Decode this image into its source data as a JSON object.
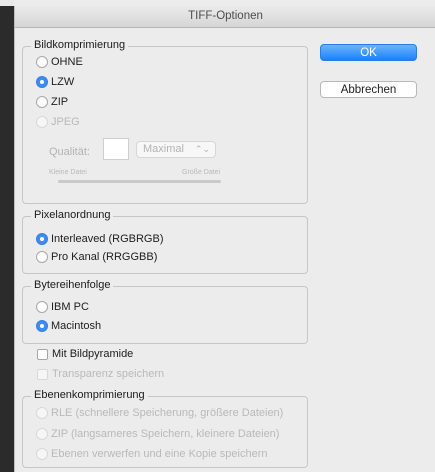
{
  "window": {
    "title": "TIFF-Optionen"
  },
  "buttons": {
    "ok": "OK",
    "cancel": "Abbrechen"
  },
  "compression": {
    "legend": "Bildkomprimierung",
    "options": [
      {
        "label": "OHNE",
        "selected": false,
        "enabled": true
      },
      {
        "label": "LZW",
        "selected": true,
        "enabled": true
      },
      {
        "label": "ZIP",
        "selected": false,
        "enabled": true
      },
      {
        "label": "JPEG",
        "selected": false,
        "enabled": false
      }
    ],
    "quality_label": "Qualität:",
    "quality_value": "",
    "quality_select": "Maximal",
    "small_file_label": "Kleine Datei",
    "large_file_label": "Große Datei"
  },
  "pixel_order": {
    "legend": "Pixelanordnung",
    "options": [
      {
        "label": "Interleaved (RGBRGB)",
        "selected": true
      },
      {
        "label": "Pro Kanal (RRGGBB)",
        "selected": false
      }
    ]
  },
  "byte_order": {
    "legend": "Bytereihenfolge",
    "options": [
      {
        "label": "IBM PC",
        "selected": false
      },
      {
        "label": "Macintosh",
        "selected": true
      }
    ]
  },
  "checkboxes": {
    "pyramid": {
      "label": "Mit Bildpyramide",
      "checked": false,
      "enabled": true
    },
    "transparency": {
      "label": "Transparenz speichern",
      "checked": false,
      "enabled": false
    }
  },
  "layer_compression": {
    "legend": "Ebenenkomprimierung",
    "options": [
      {
        "label": "RLE (schnellere Speicherung, größere Dateien)",
        "enabled": false
      },
      {
        "label": "ZIP (langsameres Speichern, kleinere Dateien)",
        "enabled": false
      },
      {
        "label": "Ebenen verwerfen und eine Kopie speichern",
        "enabled": false
      }
    ]
  },
  "colors": {
    "accent": "#3b8df3",
    "disabled_text": "#b9b9b9",
    "background": "#ececec"
  }
}
